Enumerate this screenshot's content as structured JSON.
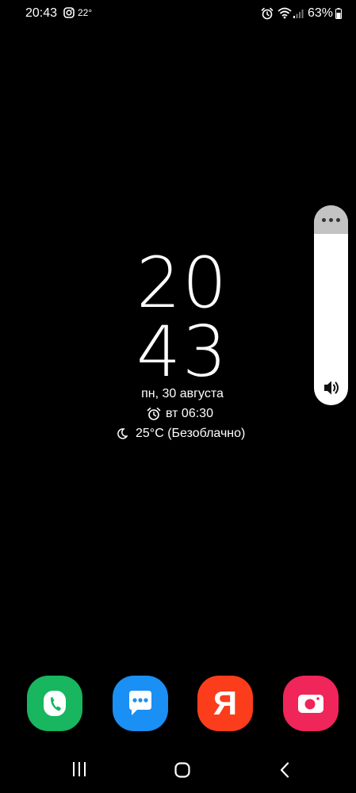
{
  "status_bar": {
    "time": "20:43",
    "notification_icons": [
      "instagram-icon"
    ],
    "temperature": "22°",
    "right_icons": [
      "alarm-icon",
      "wifi-icon",
      "signal-icon"
    ],
    "battery_percent": "63%",
    "battery_level": 0.63
  },
  "clock": {
    "hours": "20",
    "minutes": "43",
    "date": "пн, 30 августа",
    "alarm": "вт 06:30",
    "weather": "25°C (Безоблачно)"
  },
  "volume": {
    "icon": "speaker-icon",
    "more_icon": "more-dots-icon",
    "level": 0
  },
  "dock": {
    "apps": [
      "phone",
      "messages",
      "yandex",
      "camera"
    ],
    "yandex_label": "Я"
  },
  "nav_bar": {
    "icons": [
      "recent-apps-icon",
      "home-icon",
      "back-icon"
    ]
  },
  "colors": {
    "background": "#000000",
    "phone": "#17b65f",
    "messages": "#1a8ff4",
    "yandex": "#fb3d1c",
    "camera": "#f0255a"
  }
}
